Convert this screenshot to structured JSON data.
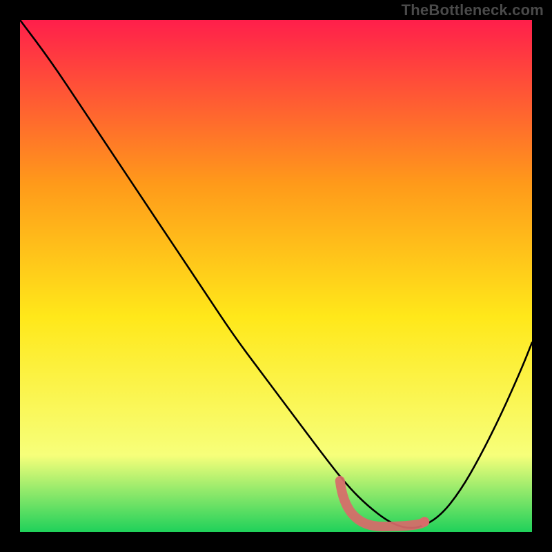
{
  "watermark": "TheBottleneck.com",
  "colors": {
    "curve": "#000000",
    "marker_fill": "#d86a6a",
    "marker_stroke": "#d86a6a",
    "frame_bg": "#000000",
    "gradient_top": "#ff1f4b",
    "gradient_mid1": "#ff9a1a",
    "gradient_mid2": "#ffe81a",
    "gradient_mid3": "#f7ff7a",
    "gradient_bottom": "#1fd15a"
  },
  "chart_data": {
    "type": "line",
    "title": "",
    "xlabel": "",
    "ylabel": "",
    "xlim": [
      0,
      100
    ],
    "ylim": [
      0,
      100
    ],
    "grid": false,
    "legend": false,
    "series": [
      {
        "name": "bottleneck_curve",
        "x": [
          0,
          6,
          12,
          18,
          24,
          30,
          36,
          42,
          48,
          54,
          60,
          64,
          68,
          72,
          75,
          78,
          82,
          86,
          90,
          94,
          98,
          100
        ],
        "values": [
          100,
          92,
          83,
          74,
          65,
          56,
          47,
          38,
          30,
          22,
          14,
          9,
          5,
          2,
          0.8,
          0.8,
          3,
          8,
          15,
          23,
          32,
          37
        ]
      }
    ],
    "marker_region": {
      "x_start": 62.5,
      "x_end": 79,
      "y_at_start": 10,
      "y_at_end": 2
    },
    "annotations": []
  }
}
